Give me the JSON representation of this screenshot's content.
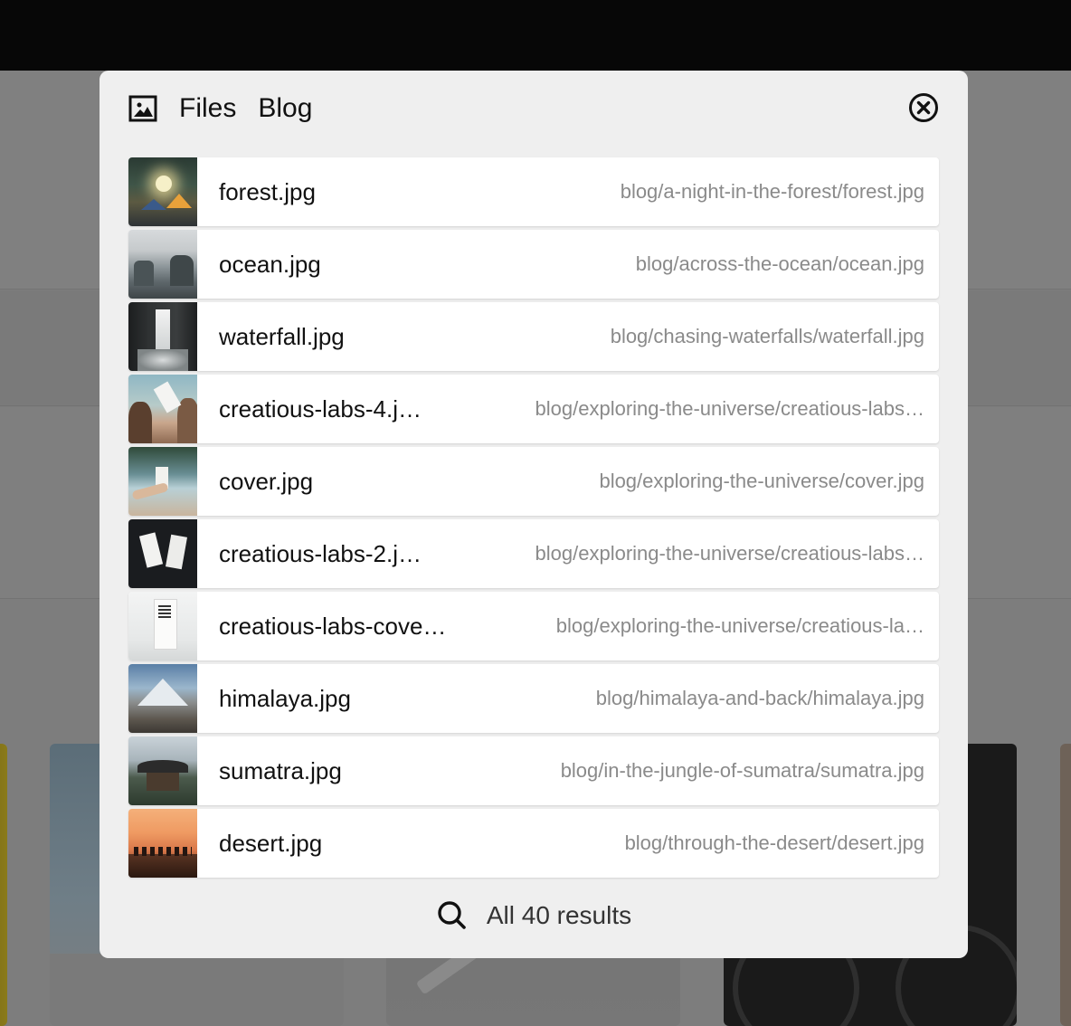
{
  "modal": {
    "title": "Files",
    "subtitle": "Blog",
    "footer_label": "All 40 results"
  },
  "results": [
    {
      "name": "forest.jpg",
      "path": "blog/a-night-in-the-forest/forest.jpg",
      "thumb": "forest"
    },
    {
      "name": "ocean.jpg",
      "path": "blog/across-the-ocean/ocean.jpg",
      "thumb": "ocean"
    },
    {
      "name": "waterfall.jpg",
      "path": "blog/chasing-waterfalls/waterfall.jpg",
      "thumb": "waterfall"
    },
    {
      "name": "creatious-labs-4.j…",
      "path": "blog/exploring-the-universe/creatious-labs…",
      "thumb": "labs4"
    },
    {
      "name": "cover.jpg",
      "path": "blog/exploring-the-universe/cover.jpg",
      "thumb": "cover"
    },
    {
      "name": "creatious-labs-2.j…",
      "path": "blog/exploring-the-universe/creatious-labs…",
      "thumb": "labs2"
    },
    {
      "name": "creatious-labs-cove…",
      "path": "blog/exploring-the-universe/creatious-la…",
      "thumb": "labscover"
    },
    {
      "name": "himalaya.jpg",
      "path": "blog/himalaya-and-back/himalaya.jpg",
      "thumb": "himalaya"
    },
    {
      "name": "sumatra.jpg",
      "path": "blog/in-the-jungle-of-sumatra/sumatra.jpg",
      "thumb": "sumatra"
    },
    {
      "name": "desert.jpg",
      "path": "blog/through-the-desert/desert.jpg",
      "thumb": "desert"
    }
  ],
  "icons": {
    "header": "image-icon",
    "close": "close-circle-icon",
    "footer": "search-icon"
  },
  "colors": {
    "modal_bg": "#efefef",
    "row_bg": "#ffffff",
    "path_text": "#8a8a8a",
    "topbar": "#070707"
  }
}
